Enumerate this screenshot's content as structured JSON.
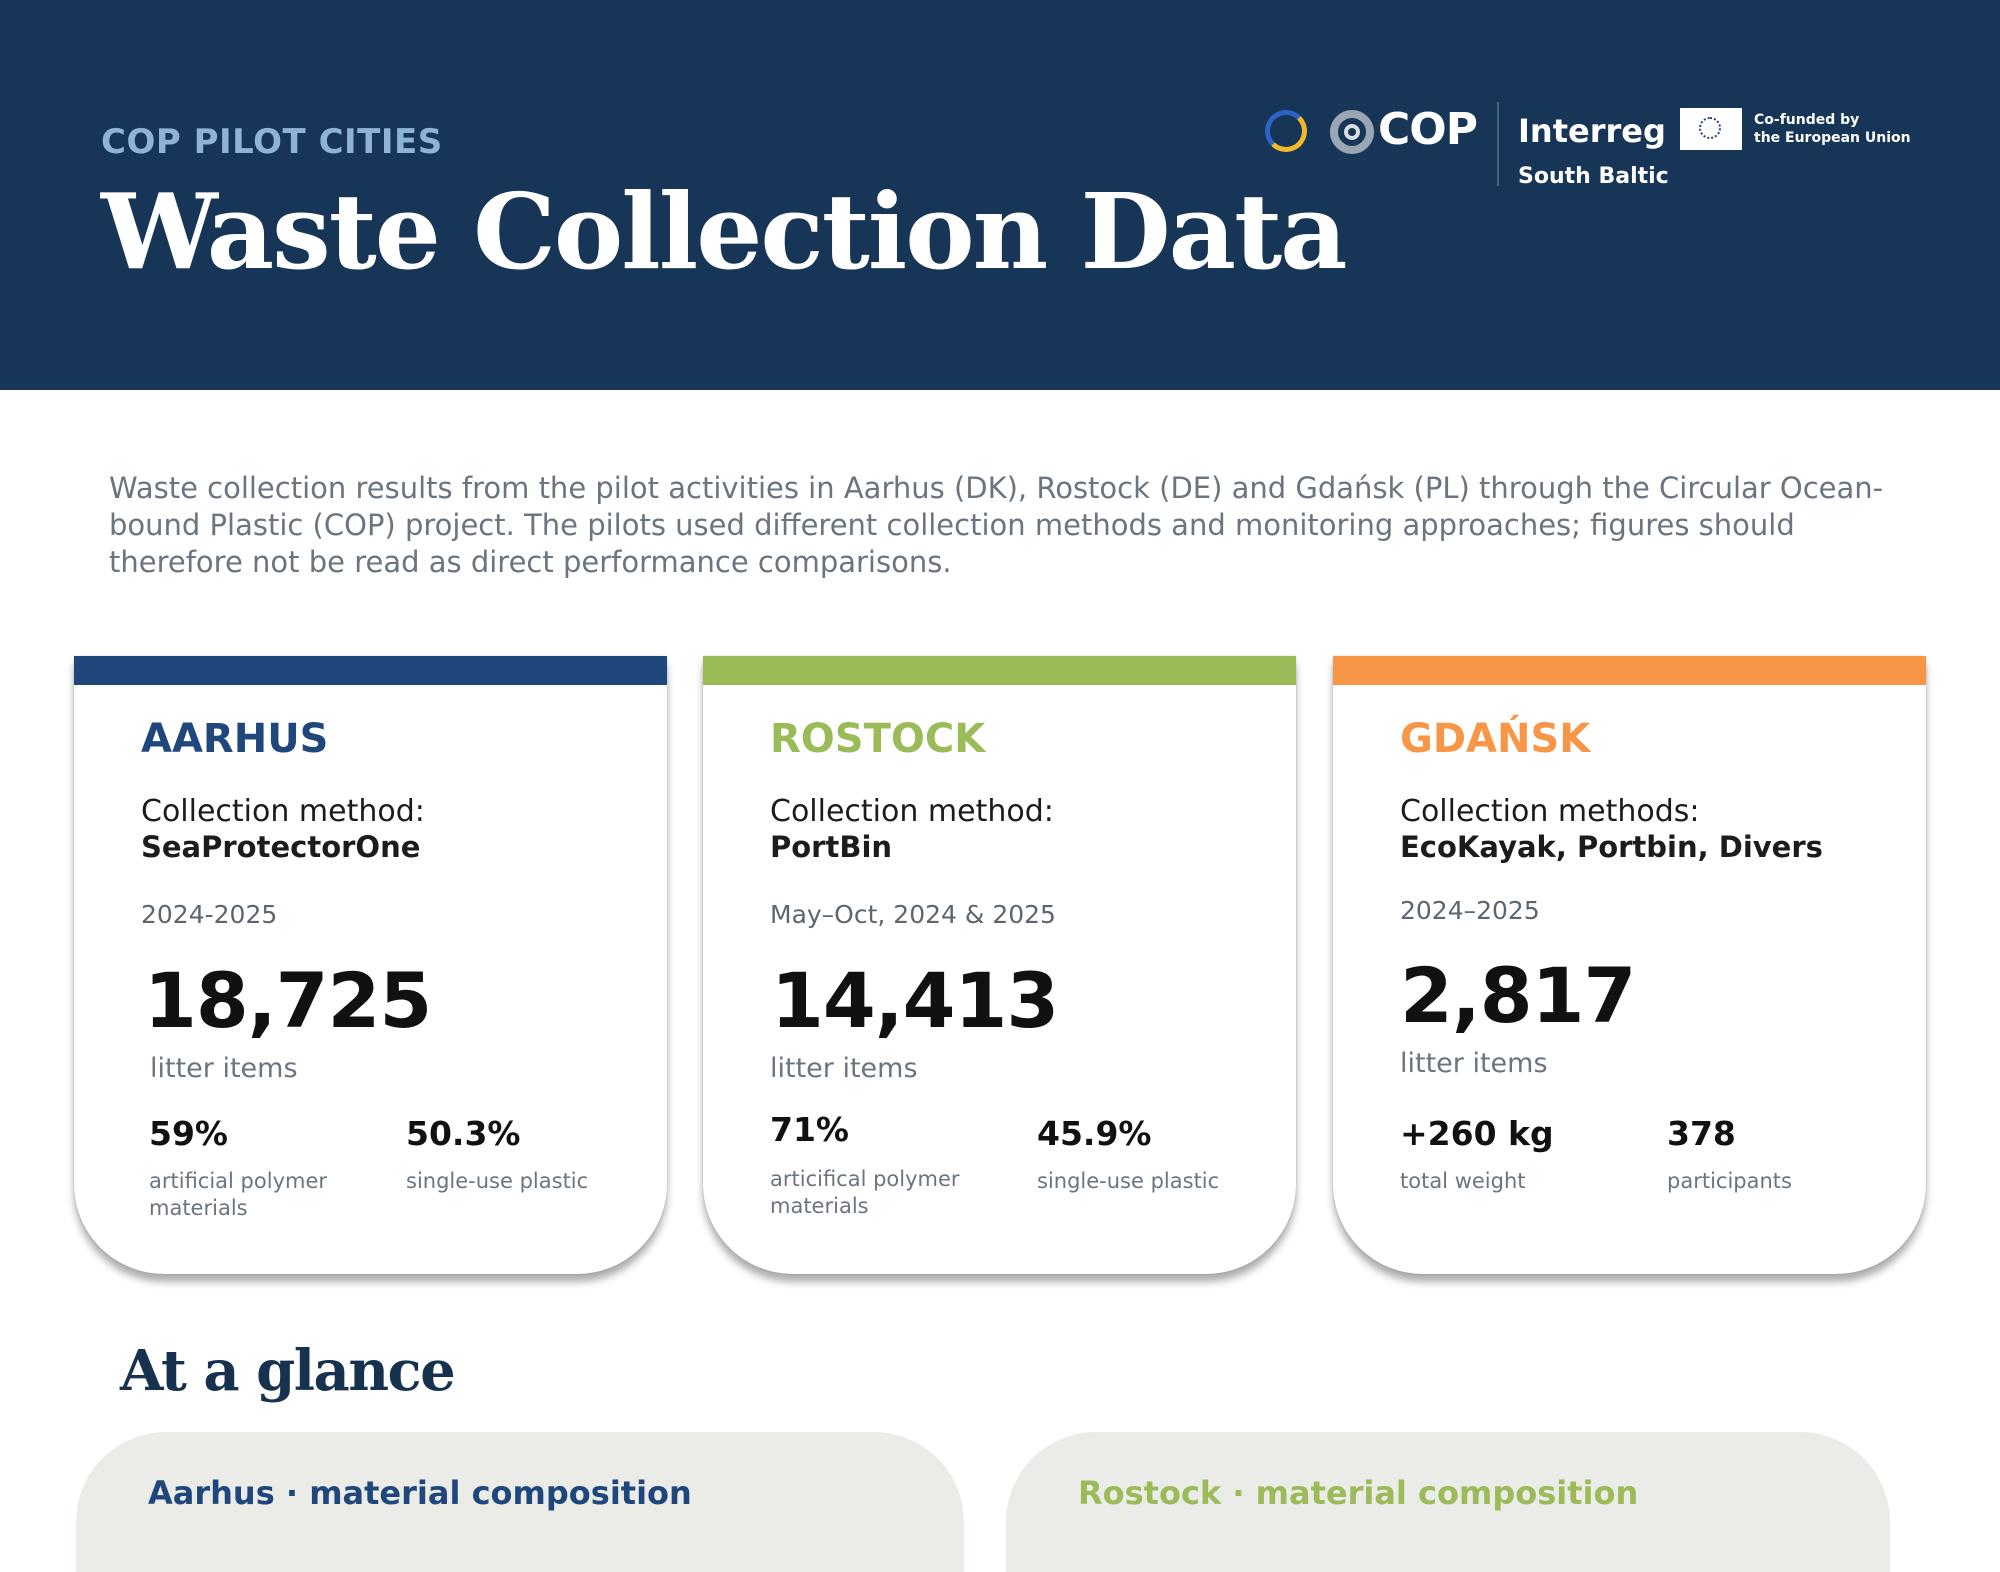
{
  "header": {
    "kicker": "COP PILOT CITIES",
    "title": "Waste Collection Data",
    "background": "#173556",
    "logos": {
      "cop": "COP",
      "interreg": "Interreg",
      "region": "South Baltic",
      "eu_line1": "Co-funded by",
      "eu_line2": "the European Union"
    }
  },
  "intro": "Waste collection results from the pilot activities in Aarhus (DK), Rostock (DE) and Gdańsk (PL) through the Circular Ocean-bound Plastic (COP) project. The pilots used different collection methods and monitoring approaches; figures should therefore not be read as direct performance comparisons.",
  "cards": [
    {
      "name": "AARHUS",
      "color": "#1f477c",
      "method_label": "Collection method:",
      "method": "SeaProtectorOne",
      "period": "2024-2025",
      "total": "18,725",
      "total_unit": "litter items",
      "stats": [
        {
          "value": "59%",
          "label": "artificial polymer materials"
        },
        {
          "value": "50.3%",
          "label": "single-use plastic"
        }
      ]
    },
    {
      "name": "ROSTOCK",
      "color": "#9bbb59",
      "method_label": "Collection method:",
      "method": "PortBin",
      "period": "May–Oct, 2024 & 2025",
      "total": "14,413",
      "total_unit": "litter items",
      "stats": [
        {
          "value": "71%",
          "label": "articifical polymer materials"
        },
        {
          "value": "45.9%",
          "label": "single-use plastic"
        }
      ]
    },
    {
      "name": "GDAŃSK",
      "color": "#f79646",
      "method_label": "Collection methods:",
      "method": "EcoKayak, Portbin, Divers",
      "period": "2024–2025",
      "total": "2,817",
      "total_unit": "litter items",
      "stats": [
        {
          "value": "+260 kg",
          "label": "total weight"
        },
        {
          "value": "378",
          "label": "participants"
        }
      ]
    }
  ],
  "glance": {
    "title": "At a glance",
    "panels": [
      {
        "title": "Aarhus · material composition",
        "color": "#1f477c"
      },
      {
        "title": "Rostock · material composition",
        "color": "#9bbb59"
      }
    ]
  }
}
